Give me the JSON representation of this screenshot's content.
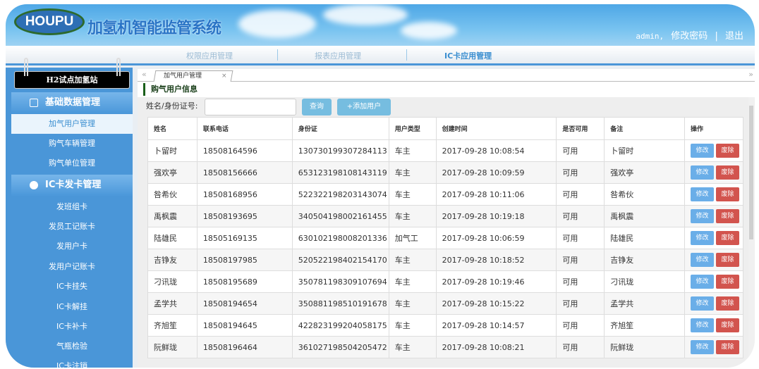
{
  "header": {
    "logo": "HOUPU",
    "title": "加氢机智能监管系统",
    "user": "admin,",
    "change_password": "修改密码",
    "separator": "|",
    "logout": "退出"
  },
  "nav": {
    "items": [
      "权限应用管理",
      "报表应用管理",
      "IC卡应用管理"
    ],
    "active": "IC卡应用管理"
  },
  "sidebar": {
    "station": "H2试点加氢站",
    "sections": [
      {
        "label": "基础数据管理",
        "items": [
          "加气用户管理",
          "购气车辆管理",
          "购气单位管理"
        ]
      },
      {
        "label": "IC卡发卡管理",
        "items": [
          "发班组卡",
          "发员工记账卡",
          "发用户卡",
          "发用户记账卡",
          "IC卡挂失",
          "IC卡解挂",
          "IC卡补卡",
          "气瓶检验",
          "IC卡注销"
        ]
      }
    ],
    "active": "加气用户管理"
  },
  "tabs": {
    "collapse_left": "«",
    "collapse_right": "»",
    "items": [
      {
        "label": "加气用户管理",
        "close": "×"
      }
    ]
  },
  "page": {
    "title": "购气用户信息",
    "search_label": "姓名/身份证号:",
    "search_value": "",
    "query_button": "查询",
    "add_button": "+添加用户"
  },
  "table": {
    "headers": [
      "姓名",
      "联系电话",
      "身份证",
      "用户类型",
      "创建时间",
      "是否可用",
      "备注",
      "操作"
    ],
    "edit_label": "修改",
    "delete_label": "废除",
    "rows": [
      [
        "卜留时",
        "18508164596",
        "130730199307284113",
        "车主",
        "2017-09-28 10:08:54",
        "可用",
        "卜留时"
      ],
      [
        "强欢亭",
        "18508156666",
        "653123198108143119",
        "车主",
        "2017-09-28 10:09:59",
        "可用",
        "强欢亭"
      ],
      [
        "咎希伙",
        "18508168956",
        "522322198203143074",
        "车主",
        "2017-09-28 10:11:06",
        "可用",
        "咎希伙"
      ],
      [
        "禹枫震",
        "18508193695",
        "340504198002161455",
        "车主",
        "2017-09-28 10:19:18",
        "可用",
        "禹枫震"
      ],
      [
        "陆雄民",
        "18505169135",
        "630102198008201336",
        "加气工",
        "2017-09-28 10:06:59",
        "可用",
        "陆雄民"
      ],
      [
        "吉铮友",
        "18508197985",
        "520522198402154170",
        "车主",
        "2017-09-28 10:18:52",
        "可用",
        "吉铮友"
      ],
      [
        "刁讯珑",
        "18508195689",
        "350781198309107694",
        "车主",
        "2017-09-28 10:19:46",
        "可用",
        "刁讯珑"
      ],
      [
        "孟学共",
        "18508194654",
        "350881198510191678",
        "车主",
        "2017-09-28 10:15:22",
        "可用",
        "孟学共"
      ],
      [
        "齐旭笙",
        "18508194645",
        "422823199204058175",
        "车主",
        "2017-09-28 10:14:57",
        "可用",
        "齐旭笙"
      ],
      [
        "阮鲜珑",
        "18508196464",
        "361027198504205472",
        "车主",
        "2017-09-28 10:08:21",
        "可用",
        "阮鲜珑"
      ]
    ]
  }
}
